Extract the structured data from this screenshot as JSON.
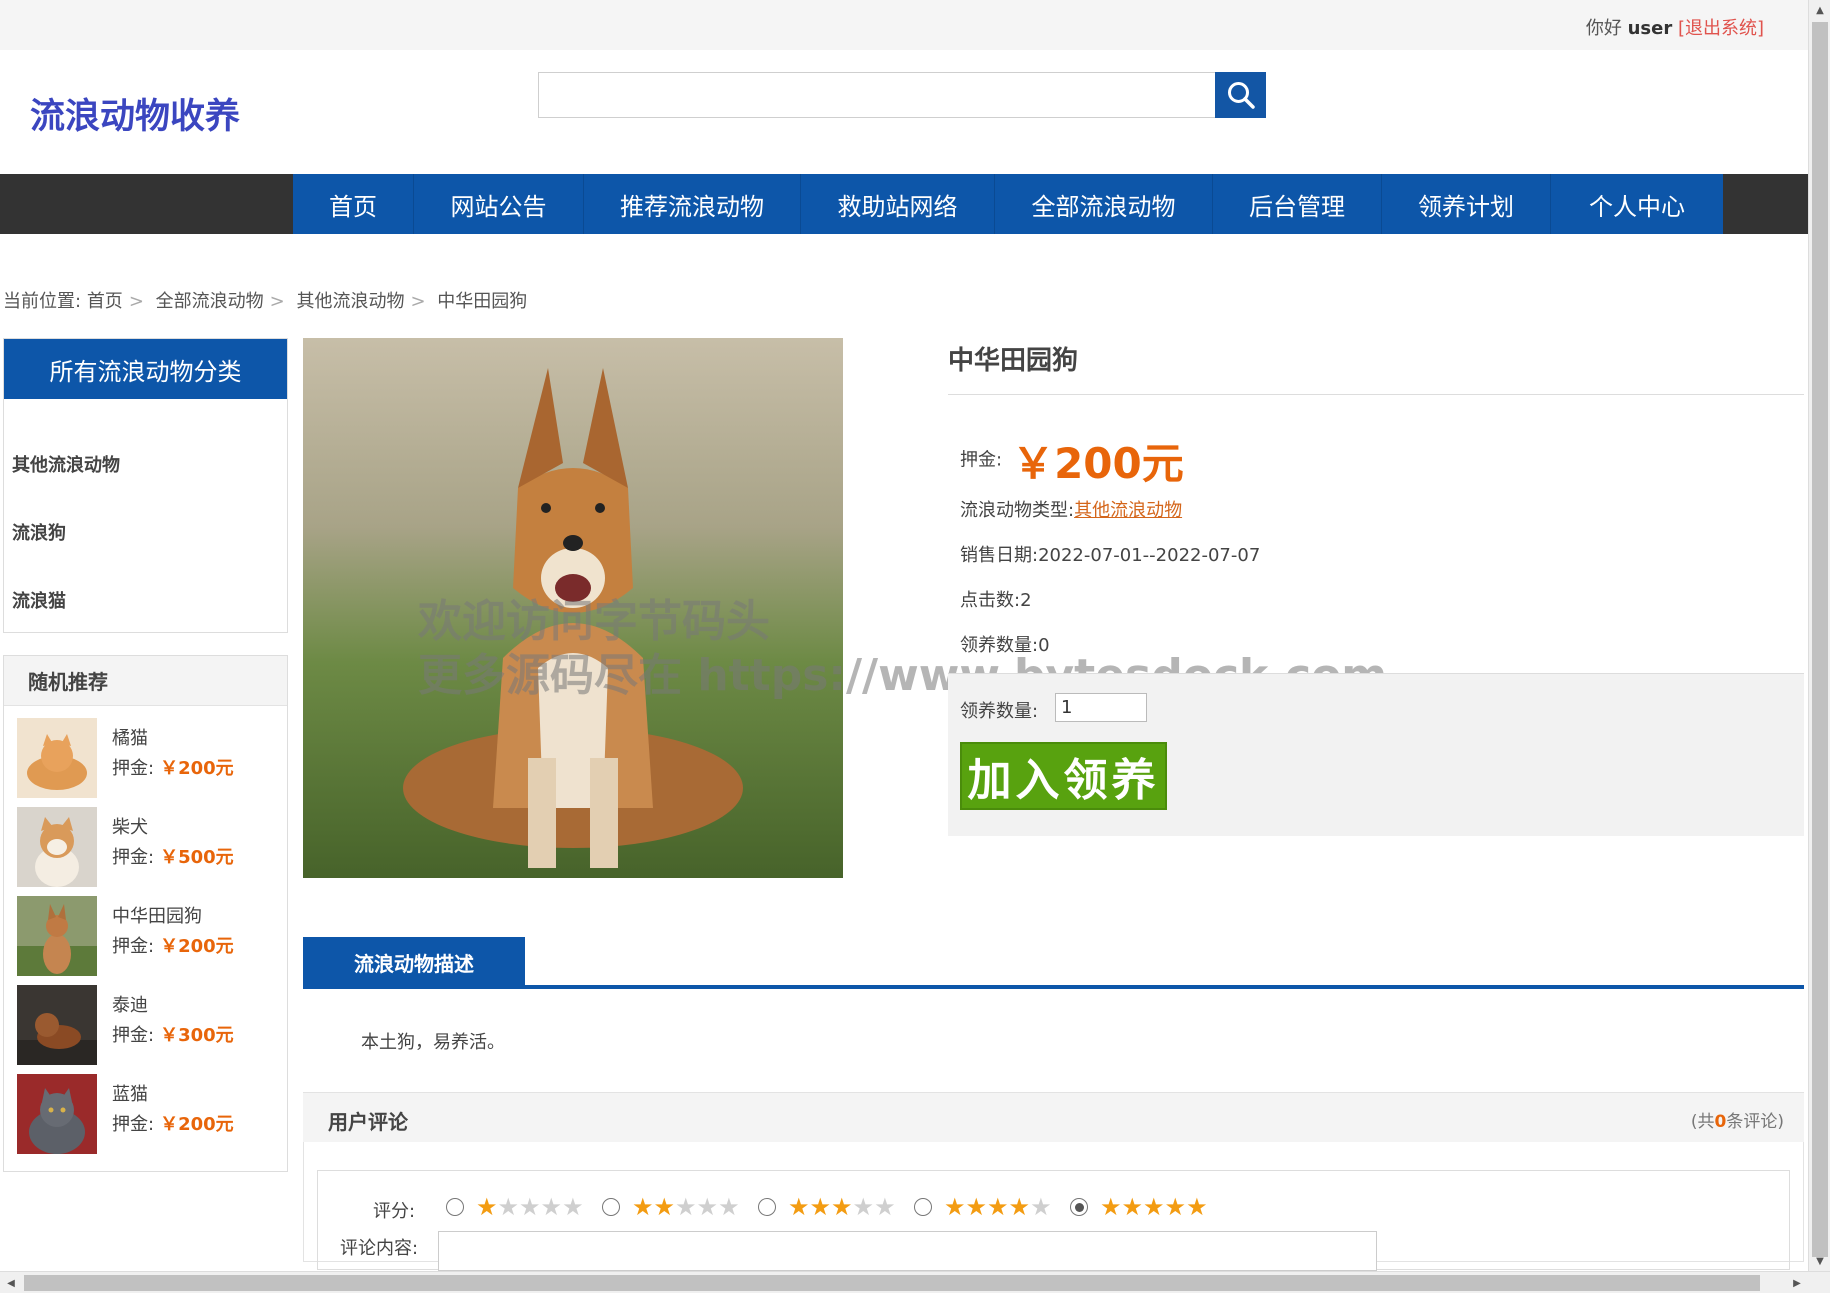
{
  "user": {
    "greeting": "你好",
    "username": "user",
    "logout": "[退出系统]"
  },
  "site": {
    "logo": "流浪动物收养"
  },
  "search": {
    "placeholder": ""
  },
  "nav": [
    {
      "label": "首页"
    },
    {
      "label": "网站公告"
    },
    {
      "label": "推荐流浪动物"
    },
    {
      "label": "救助站网络"
    },
    {
      "label": "全部流浪动物"
    },
    {
      "label": "后台管理"
    },
    {
      "label": "领养计划"
    },
    {
      "label": "个人中心"
    }
  ],
  "breadcrumb": {
    "prefix": "当前位置:",
    "items": [
      "首页",
      "全部流浪动物",
      "其他流浪动物",
      "中华田园狗"
    ]
  },
  "categories": {
    "title": "所有流浪动物分类",
    "items": [
      "其他流浪动物",
      "流浪狗",
      "流浪猫"
    ]
  },
  "recommend": {
    "title": "随机推荐",
    "price_label": "押金:",
    "items": [
      {
        "name": "橘猫",
        "price": "￥200元"
      },
      {
        "name": "柴犬",
        "price": "￥500元"
      },
      {
        "name": "中华田园狗",
        "price": "￥200元"
      },
      {
        "name": "泰迪",
        "price": "￥300元"
      },
      {
        "name": "蓝猫",
        "price": "￥200元"
      }
    ]
  },
  "watermark": {
    "line1": "欢迎访问字节码头",
    "line2": "更多源码尽在  https://www.bytesdock.com"
  },
  "product": {
    "title": "中华田园狗",
    "deposit_label": "押金:",
    "deposit_value": "￥200元",
    "type_label": "流浪动物类型:",
    "type_value": "其他流浪动物",
    "date_label": "销售日期:",
    "date_value": "2022-07-01--2022-07-07",
    "clicks_label": "点击数:",
    "clicks_value": "2",
    "adopt_count_label": "领养数量:",
    "adopt_count_value": "0",
    "qty_label": "领养数量:",
    "qty_value": "1",
    "add_button": "加入领养"
  },
  "tab": {
    "label": "流浪动物描述"
  },
  "description": "本土狗，易养活。",
  "comments": {
    "title": "用户评论",
    "count_prefix": "(共",
    "count": "0",
    "count_suffix": "条评论)",
    "rating_label": "评分:",
    "content_label": "评论内容:",
    "ratings": [
      1,
      2,
      3,
      4,
      5
    ],
    "selected_rating": 5
  },
  "colors": {
    "primary": "#0d56a9",
    "accent": "#e8650a",
    "button_green": "#58a20f",
    "logo": "#3b46c0"
  }
}
